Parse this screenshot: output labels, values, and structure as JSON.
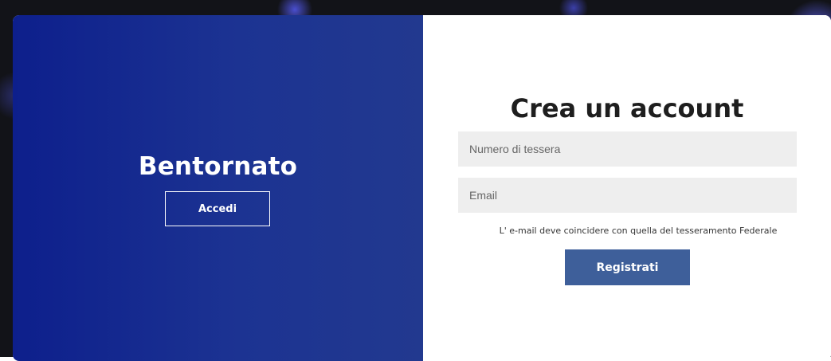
{
  "welcome_panel": {
    "title": "Bentornato",
    "login_label": "Accedi"
  },
  "register_panel": {
    "title": "Crea un account",
    "card_number_placeholder": "Numero di tessera",
    "email_placeholder": "Email",
    "hint": "L' e-mail deve coincidere con quella del tesseramento Federale",
    "register_label": "Registrati"
  },
  "colors": {
    "left_panel_start": "#0d1f8c",
    "left_panel_end": "#22398f",
    "register_button": "#3e5f9a",
    "field_background": "#eeeeee"
  }
}
